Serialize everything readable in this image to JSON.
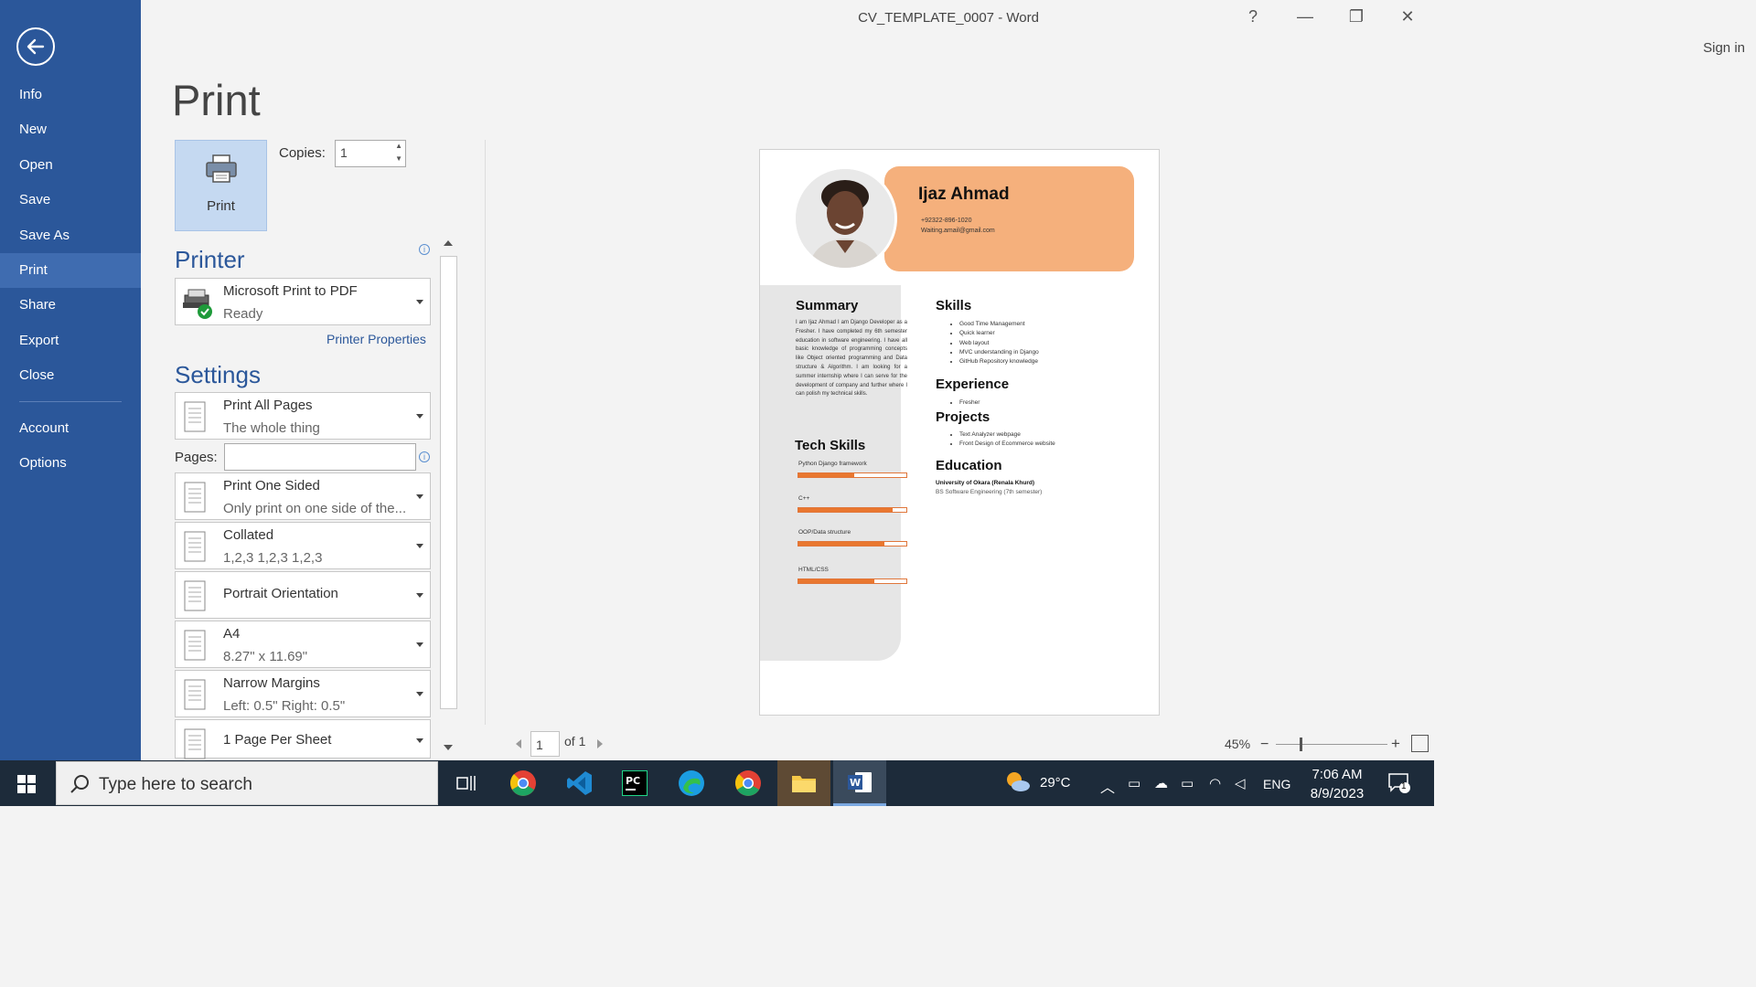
{
  "window": {
    "title": "CV_TEMPLATE_0007 - Word",
    "help": "?",
    "minimize": "—",
    "restore": "❐",
    "close": "✕",
    "sign_in": "Sign in"
  },
  "nav": {
    "items": [
      {
        "label": "Info"
      },
      {
        "label": "New"
      },
      {
        "label": "Open"
      },
      {
        "label": "Save"
      },
      {
        "label": "Save As"
      },
      {
        "label": "Print",
        "active": true
      },
      {
        "label": "Share"
      },
      {
        "label": "Export"
      },
      {
        "label": "Close"
      }
    ],
    "bottom_items": [
      {
        "label": "Account"
      },
      {
        "label": "Options"
      }
    ]
  },
  "print": {
    "title": "Print",
    "button_label": "Print",
    "copies_label": "Copies:",
    "copies_value": "1",
    "printer_heading": "Printer",
    "printer_name": "Microsoft Print to PDF",
    "printer_status": "Ready",
    "printer_properties": "Printer Properties",
    "settings_heading": "Settings",
    "pages_label": "Pages:",
    "pages_value": "",
    "settings": [
      {
        "line1": "Print All Pages",
        "line2": "The whole thing"
      },
      {
        "line1": "Print One Sided",
        "line2": "Only print on one side of the..."
      },
      {
        "line1": "Collated",
        "line2": "1,2,3    1,2,3    1,2,3"
      },
      {
        "line1": "Portrait Orientation",
        "line2": ""
      },
      {
        "line1": "A4",
        "line2": "8.27\" x 11.69\""
      },
      {
        "line1": "Narrow Margins",
        "line2": "Left:  0.5\"    Right:  0.5\""
      },
      {
        "line1": "1 Page Per Sheet",
        "line2": ""
      }
    ]
  },
  "preview": {
    "page_current": "1",
    "page_of": "of 1",
    "zoom": "45%"
  },
  "cv": {
    "name": "Ijaz Ahmad",
    "phone": "+92322-896-1020",
    "email": "Waiting.amail@gmail.com",
    "summary_heading": "Summary",
    "summary_text": "I am Ijaz Ahmad I am Django Developer as a Fresher. I have completed my 6th semester education in software engineering. I have all basic knowledge of programming concepts like Object oriented programming and Data structure & Algorithm. I am looking for a summer internship where I can serve for the development of company and further where I can polish my technical skills.",
    "tech_heading": "Tech Skills",
    "tech_skills": [
      {
        "name": "Python Django framework",
        "level": 0.52
      },
      {
        "name": "C++",
        "level": 0.87
      },
      {
        "name": "OOP/Data structure",
        "level": 0.8
      },
      {
        "name": "HTML/CSS",
        "level": 0.7
      }
    ],
    "skills_heading": "Skills",
    "skills": [
      "Good Time Management",
      "Quick learner",
      "Web layout",
      "MVC understanding in Django",
      "GitHub Repository knowledge"
    ],
    "experience_heading": "Experience",
    "experience": [
      "Fresher"
    ],
    "projects_heading": "Projects",
    "projects": [
      "Text Analyzer webpage",
      "Front Design of Ecommerce website"
    ],
    "education_heading": "Education",
    "education_school": "University of Okara (Renala Khurd)",
    "education_degree": "BS Software Engineering (7th semester)"
  },
  "taskbar": {
    "search_placeholder": "Type here to search",
    "weather": "29°C",
    "language": "ENG",
    "time": "7:06 AM",
    "date": "8/9/2023",
    "notification_count": "1"
  }
}
